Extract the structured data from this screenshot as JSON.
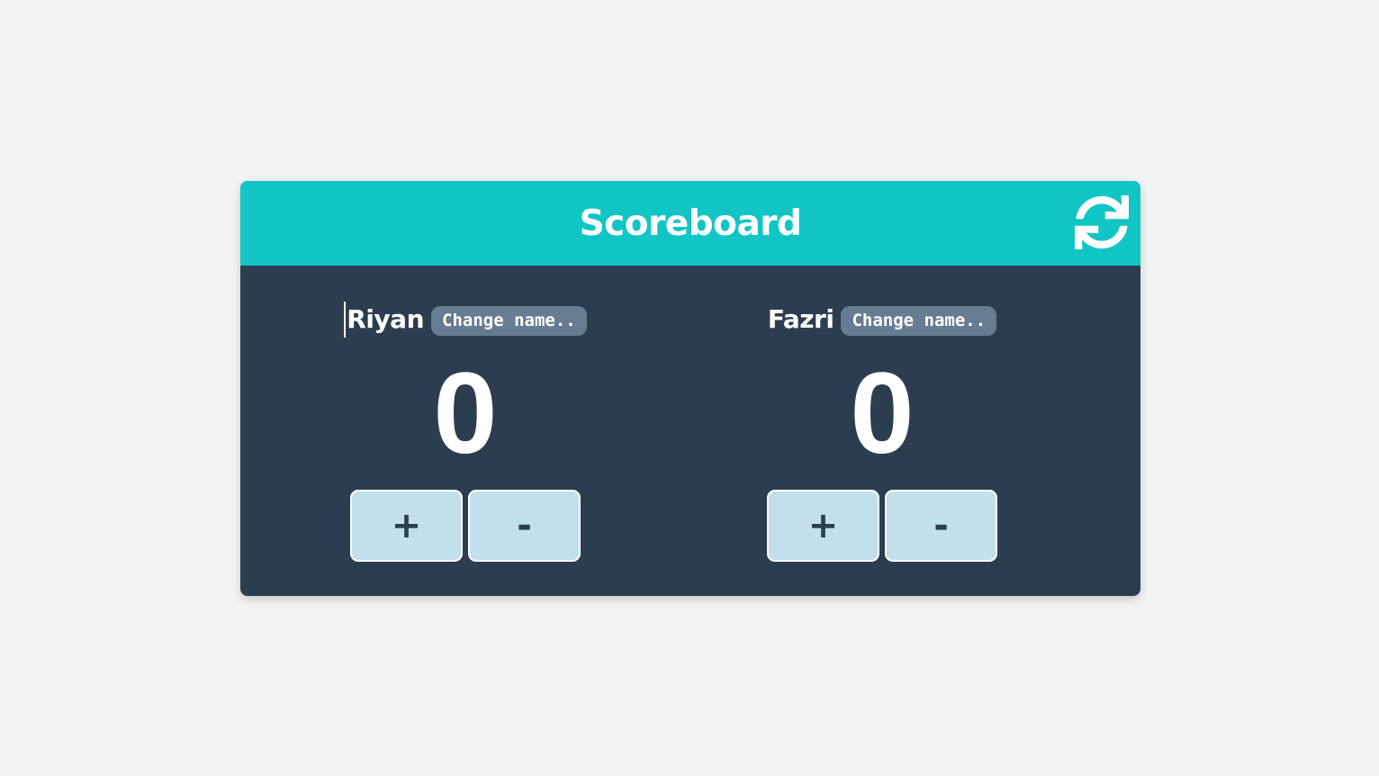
{
  "header": {
    "title": "Scoreboard",
    "reset_icon": "refresh-icon"
  },
  "players": [
    {
      "name": "Riyan",
      "change_label": "Change name..",
      "score": "0",
      "plus_label": "+",
      "minus_label": "-"
    },
    {
      "name": "Fazri",
      "change_label": "Change name..",
      "score": "0",
      "plus_label": "+",
      "minus_label": "-"
    }
  ],
  "colors": {
    "header_bg": "#12c5c5",
    "body_bg": "#2d3d50",
    "button_bg": "#c2dfeb",
    "change_name_bg": "#667c93",
    "page_bg": "#f2f3f5"
  }
}
